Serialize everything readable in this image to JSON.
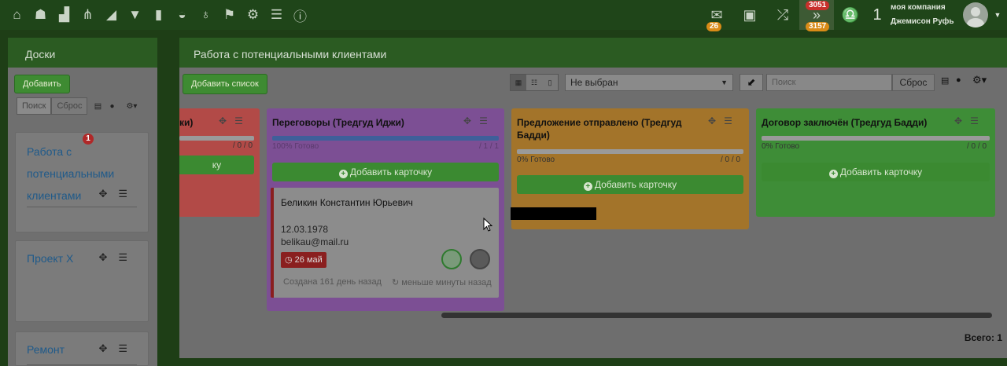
{
  "topbar": {
    "mail_badge": "26",
    "notif_badge_top": "3051",
    "notif_badge_bottom": "3157",
    "counter": "1",
    "company": "моя компания",
    "user": "Джемисон Руфь"
  },
  "sidebar": {
    "title": "Доски",
    "add_label": "Добавить",
    "search_tab": "Поиск",
    "reset_tab": "Сброс",
    "boards": [
      {
        "title": "Работа с потенциальными клиентами",
        "badge": "1"
      },
      {
        "title": "Проект X"
      },
      {
        "title": "Ремонт"
      }
    ]
  },
  "main": {
    "title": "Работа с потенциальными клиентами",
    "add_list_label": "Добавить список",
    "select_value": "Не выбран",
    "search_placeholder": "Поиск",
    "reset_label": "Сброс",
    "total_label": "Всего: 1"
  },
  "columns": [
    {
      "title": "ки)",
      "progress_count": "/ 0 / 0",
      "add_card": "ку",
      "color": "#b24a47"
    },
    {
      "title": "Переговоры (Тредгуд Иджи)",
      "progress_text": "100% Готово",
      "progress_count": "/ 1 / 1",
      "add_card": "Добавить карточку",
      "color": "#7c4f94"
    },
    {
      "title": "Предложение отправлено (Тредгуд Бадди)",
      "progress_text": "0% Готово",
      "progress_count": "/ 0 / 0",
      "add_card": "Добавить карточку",
      "color": "#a3742a"
    },
    {
      "title": "Договор заключён (Тредгуд Бадди)",
      "progress_text": "0% Готово",
      "progress_count": "/ 0 / 0",
      "add_card": "Добавить карточку",
      "color": "#3e8d37"
    }
  ],
  "card": {
    "name": "Беликин Константин Юрьевич",
    "date": "12.03.1978",
    "email": "belikau@mail.ru",
    "due": "26 май",
    "created": "Создана 161 день назад",
    "updated": "меньше минуты назад"
  }
}
